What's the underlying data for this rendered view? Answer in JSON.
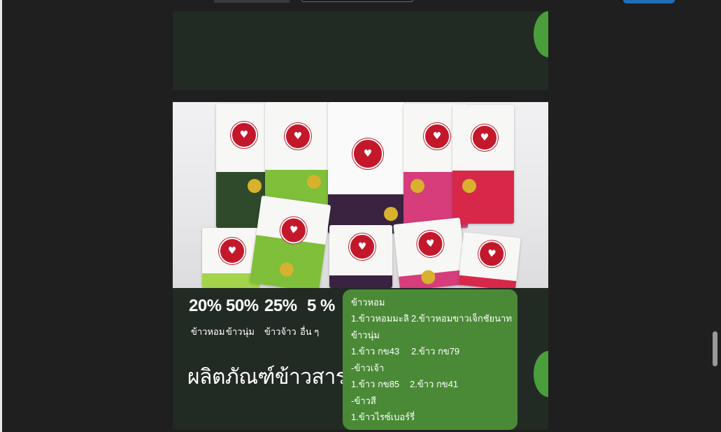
{
  "colors": {
    "background": "#1f1f1f",
    "slide_bg": "#222a24",
    "green_accent": "#4a9e3c",
    "info_box": "#4a8a37",
    "brand_red": "#c3182b",
    "top_button_blue": "#1f6fb8"
  },
  "stats": [
    {
      "value": "20%",
      "label": "ข้าวหอม"
    },
    {
      "value": "50%",
      "label": "ข้าวนุ่ม"
    },
    {
      "value": "25%",
      "label": "ข้าวจ้าว"
    },
    {
      "value": "5 %",
      "label": "อื่น ๆ"
    }
  ],
  "title": "ผลิตภัณฑ์ข้าวสาร",
  "info": {
    "lines": [
      "ข้าวหอม",
      "1.ข้าวหอมมะลิ",
      "2.ข้าวหอมขาวเจ็กชัยนาท",
      "ข้าวนุ่ม",
      "1.ข้าว กข43",
      "2.ข้าว กข79",
      "-ข้าวเจ้า",
      "1.ข้าว กข85",
      "2.ข้าว กข41",
      "-ข้าวสี",
      "1.ข้าวไรซ์เบอร์รี่"
    ]
  },
  "photo": {
    "icon": "rice-packages-image",
    "packs": [
      {
        "band": "#2f4a2a"
      },
      {
        "band": "#7fbf3a"
      },
      {
        "band": "#3a2340"
      },
      {
        "band": "#d63d7a"
      },
      {
        "band": "#d8284a"
      },
      {
        "band": "#a3d44a"
      },
      {
        "band": "#7fbf3a"
      },
      {
        "band": "#3a2340"
      },
      {
        "band": "#d63d7a"
      },
      {
        "band": "#d8284a"
      }
    ]
  }
}
